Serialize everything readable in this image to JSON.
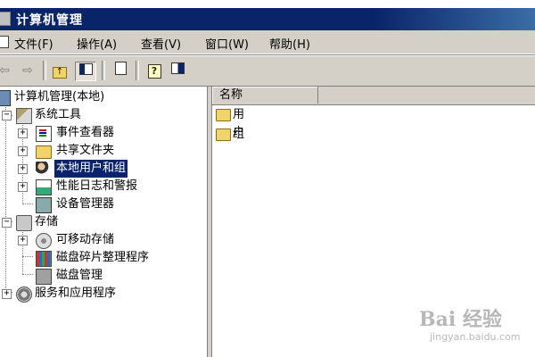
{
  "window": {
    "title": "计算机管理"
  },
  "menu": [
    "文件(F)",
    "操作(A)",
    "查看(V)",
    "窗口(W)",
    "帮助(H)"
  ],
  "toolbar": {
    "buttons": [
      "back-icon",
      "forward-icon",
      "up-icon",
      "show-tree-icon",
      "properties-icon",
      "help-icon",
      "panel-icon"
    ]
  },
  "tree": {
    "root": "计算机管理(本地)",
    "system_tools": "系统工具",
    "event_viewer": "事件查看器",
    "shared_folders": "共享文件夹",
    "local_users_groups": "本地用户和组",
    "perf_logs": "性能日志和警报",
    "device_manager": "设备管理器",
    "storage": "存储",
    "removable_storage": "可移动存储",
    "defrag": "磁盘碎片整理程序",
    "disk_management": "磁盘管理",
    "services_apps": "服务和应用程序"
  },
  "list": {
    "column_name": "名称",
    "items": [
      "用户",
      "组"
    ]
  },
  "watermark": {
    "brand": "Bai 经验",
    "url": "jingyan.baidu.com"
  }
}
